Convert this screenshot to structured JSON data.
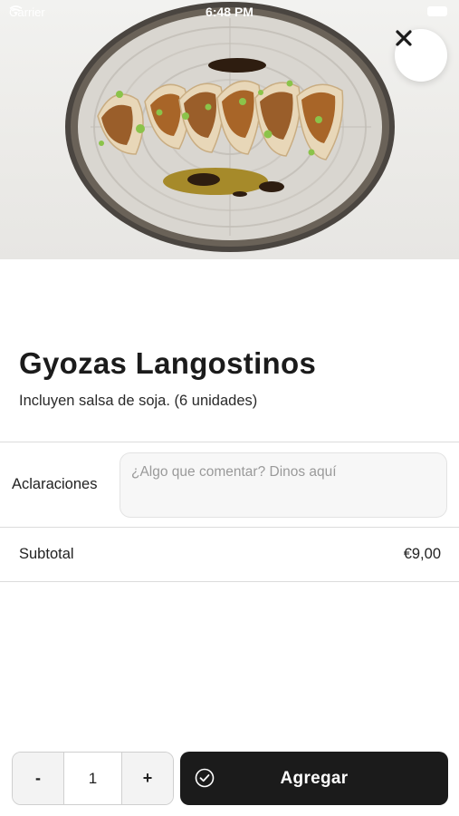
{
  "status_bar": {
    "carrier": "Carrier",
    "time": "6:48 PM"
  },
  "hero": {
    "image_alt": "Gyozas de langostinos en plato de cerámica con salsa de soja"
  },
  "product": {
    "title": "Gyozas Langostinos",
    "description": "Incluyen salsa de soja. (6 unidades)"
  },
  "notes": {
    "label": "Aclaraciones",
    "placeholder": "¿Algo que comentar? Dinos aquí",
    "value": ""
  },
  "subtotal": {
    "label": "Subtotal",
    "value": "€9,00"
  },
  "quantity": {
    "decrement_label": "-",
    "value": "1",
    "increment_label": "+"
  },
  "add_button": {
    "label": "Agregar"
  },
  "icons": {
    "close": "close-icon",
    "check": "check-circle-icon",
    "wifi": "wifi-icon",
    "battery": "battery-icon"
  },
  "colors": {
    "primary_button": "#1b1b1b",
    "background": "#ffffff",
    "divider": "#dcdcdc"
  }
}
